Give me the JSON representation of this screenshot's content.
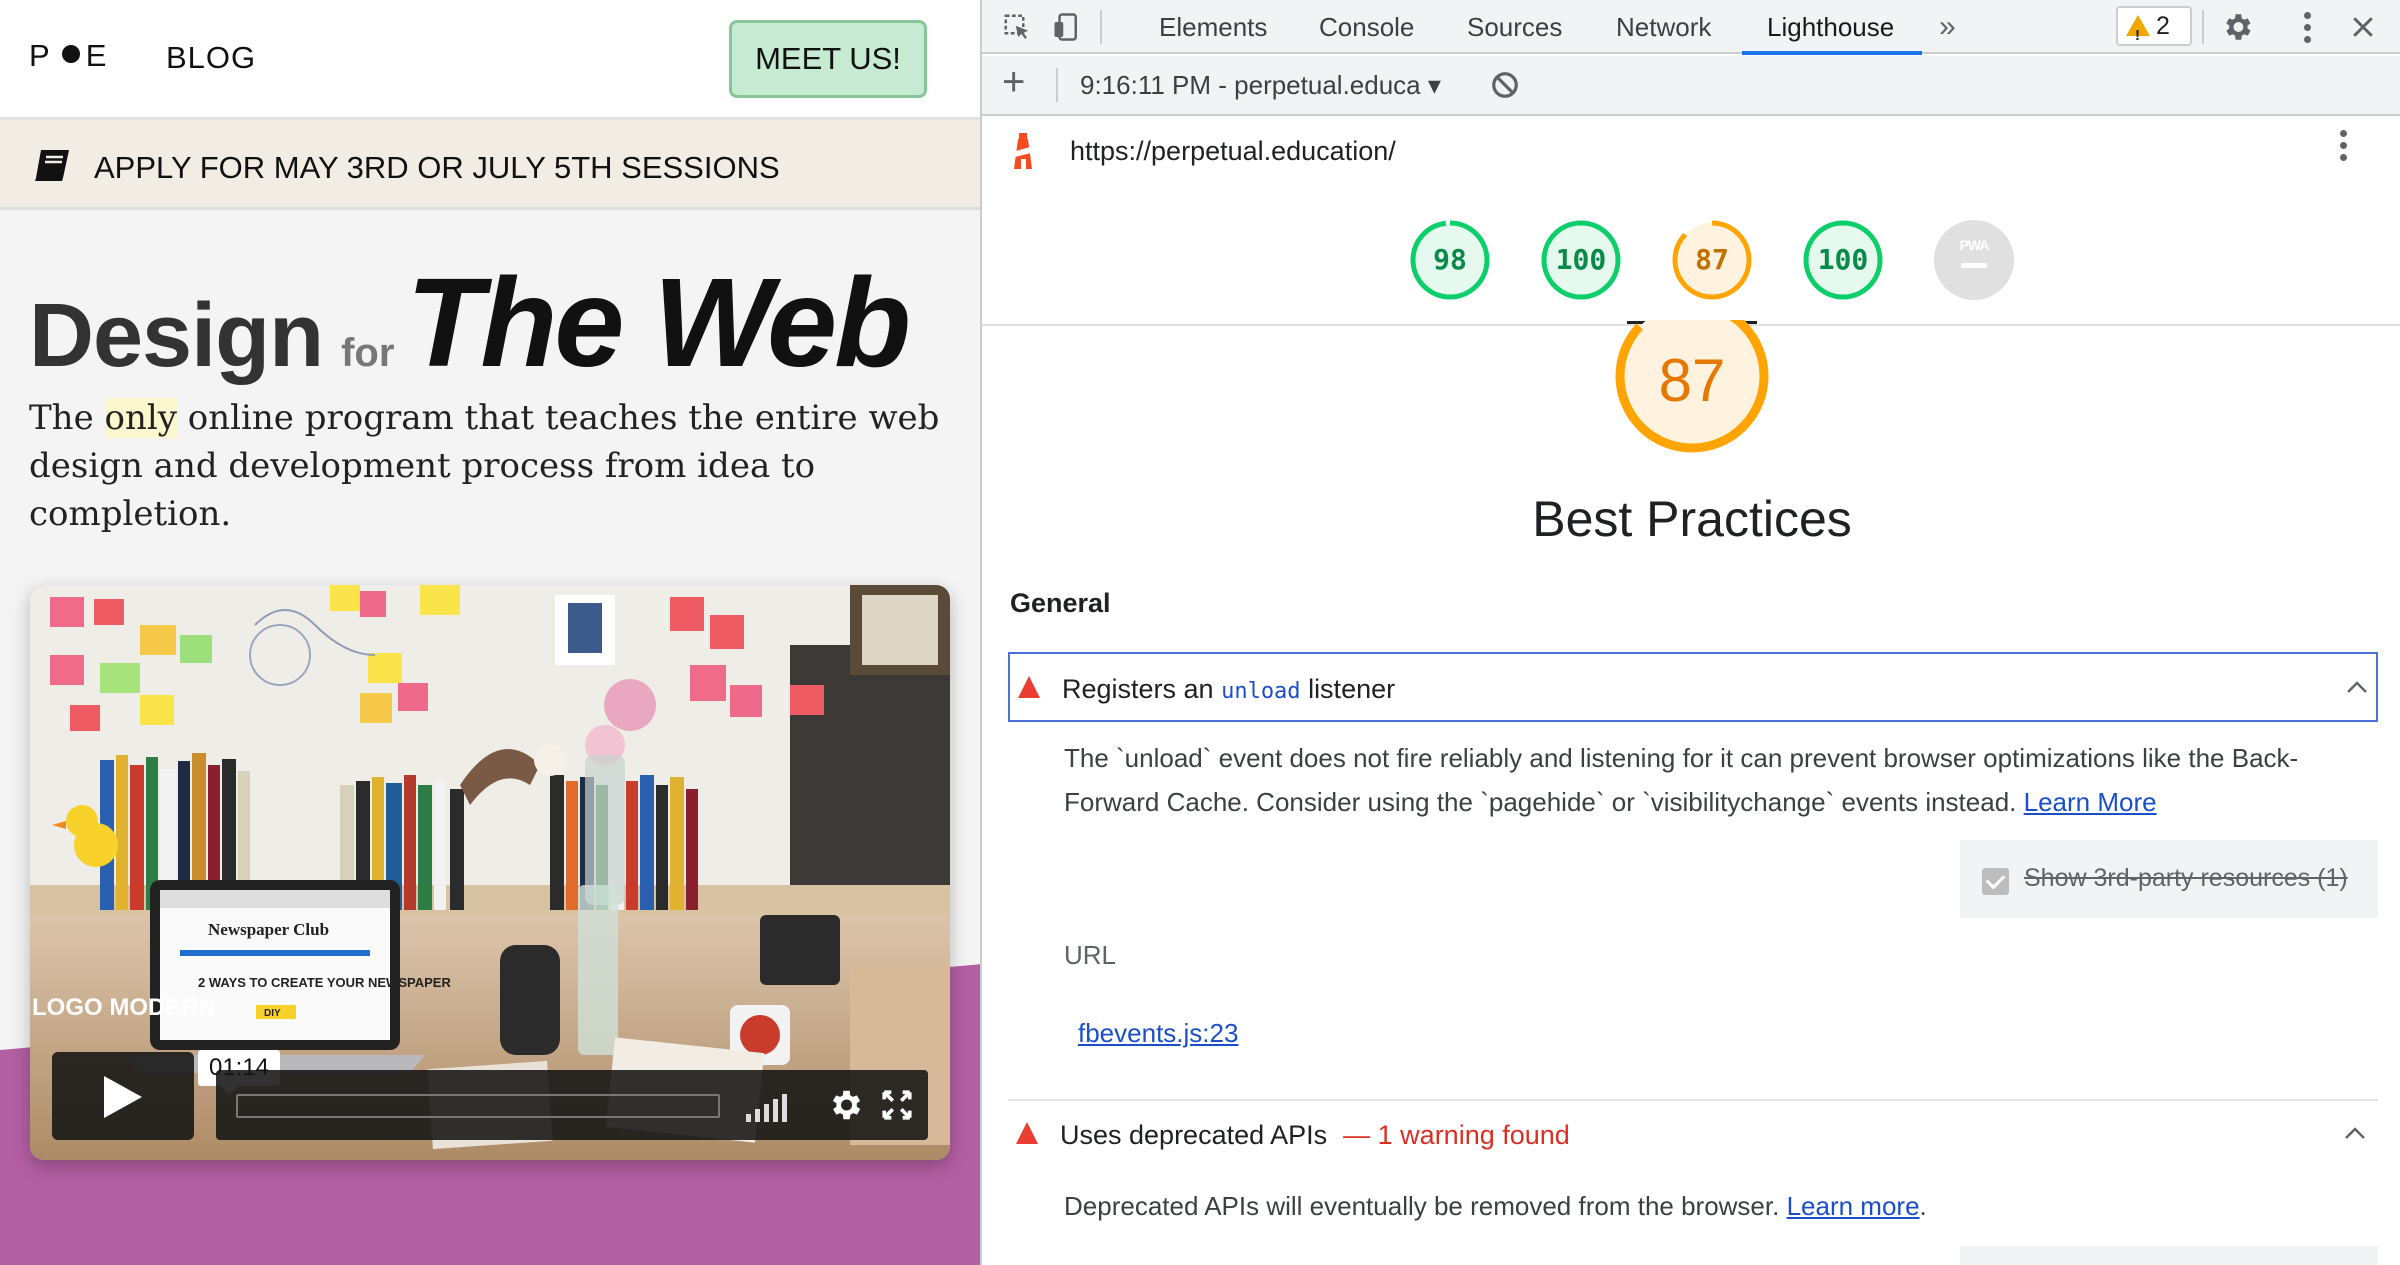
{
  "site": {
    "logo_left": "P",
    "logo_right": "E",
    "nav_blog": "BLOG",
    "cta": "MEET US!",
    "banner": "APPLY FOR MAY 3RD OR JULY 5TH SESSIONS",
    "hero": {
      "title_a": "Design",
      "title_for": "for",
      "title_b": "The Web",
      "sub_pre": "The ",
      "sub_highlight": "only",
      "sub_post": " online program that teaches the entire web design and development process from idea to completion."
    },
    "video": {
      "timecode": "01:14",
      "laptop_text_a": "Newspaper Club",
      "laptop_text_b": "2 WAYS TO CREATE YOUR NEWSPAPER",
      "laptop_text_c": "DIY",
      "shelf_text": "LOGO MODERN"
    }
  },
  "devtools": {
    "tabs": [
      "Elements",
      "Console",
      "Sources",
      "Network",
      "Lighthouse"
    ],
    "active_tab": "Lighthouse",
    "more_tabs": "»",
    "warning_count": "2",
    "session": "9:16:11 PM - perpetual.educa ▾",
    "url": "https://perpetual.education/",
    "scores": [
      {
        "label": "98",
        "value": 98,
        "color": "#0cce6b"
      },
      {
        "label": "100",
        "value": 100,
        "color": "#0cce6b"
      },
      {
        "label": "87",
        "value": 87,
        "color": "#ffa400"
      },
      {
        "label": "100",
        "value": 100,
        "color": "#0cce6b"
      }
    ],
    "pwa_label": "PWA",
    "category": {
      "score": "87",
      "title": "Best Practices"
    },
    "group": "General",
    "audits": [
      {
        "title_pre": "Registers an ",
        "title_code": "unload",
        "title_post": " listener",
        "description": "The `unload` event does not fire reliably and listening for it can prevent browser optimizations like the Back-Forward Cache. Consider using the `pagehide` or `visibilitychange` events instead.",
        "learn_more": "Learn More",
        "third_party_label": "Show 3rd-party resources (1)",
        "table_header": "URL",
        "table_value": "fbevents.js:23"
      },
      {
        "title": "Uses deprecated APIs",
        "warning": "— 1 warning found",
        "description": "Deprecated APIs will eventually be removed from the browser.",
        "learn_more": "Learn more",
        "trailing": "."
      }
    ],
    "colors": {
      "pass": "#0cce6b",
      "average": "#ffa400",
      "fail": "#eb3d32",
      "active_tab": "#1a73e8"
    }
  }
}
